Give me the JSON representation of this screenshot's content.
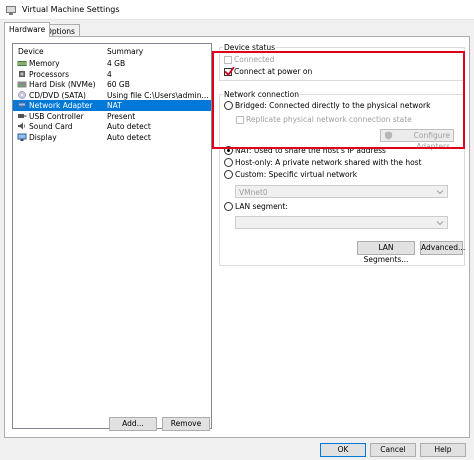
{
  "window": {
    "title": "Virtual Machine Settings"
  },
  "tabs": [
    {
      "label": "Hardware",
      "active": true
    },
    {
      "label": "Options",
      "active": false
    }
  ],
  "device_list": {
    "headers": {
      "device": "Device",
      "summary": "Summary"
    },
    "rows": [
      {
        "device": "Memory",
        "summary": "4 GB",
        "icon": "memory-icon",
        "selected": false
      },
      {
        "device": "Processors",
        "summary": "4",
        "icon": "processor-icon",
        "selected": false
      },
      {
        "device": "Hard Disk (NVMe)",
        "summary": "60 GB",
        "icon": "hard-disk-icon",
        "selected": false
      },
      {
        "device": "CD/DVD (SATA)",
        "summary": "Using file C:\\Users\\admin...",
        "icon": "cd-dvd-icon",
        "selected": false
      },
      {
        "device": "Network Adapter",
        "summary": "NAT",
        "icon": "network-adapter-icon",
        "selected": true
      },
      {
        "device": "USB Controller",
        "summary": "Present",
        "icon": "usb-icon",
        "selected": false
      },
      {
        "device": "Sound Card",
        "summary": "Auto detect",
        "icon": "sound-card-icon",
        "selected": false
      },
      {
        "device": "Display",
        "summary": "Auto detect",
        "icon": "display-icon",
        "selected": false
      }
    ],
    "add_label": "Add...",
    "remove_label": "Remove"
  },
  "device_status": {
    "legend": "Device status",
    "connected_label": "Connected",
    "connected": false,
    "connect_power_label": "Connect at power on",
    "connect_power": true
  },
  "network_connection": {
    "legend": "Network connection",
    "bridged_label": "Bridged: Connected directly to the physical network",
    "replicate_label": "Replicate physical network connection state",
    "configure_adapters_label": "Configure Adapters",
    "nat_label": "NAT: Used to share the host's IP address",
    "host_only_label": "Host-only: A private network shared with the host",
    "custom_label": "Custom: Specific virtual network",
    "custom_value": "VMnet0",
    "lan_segment_label": "LAN segment:",
    "lan_segment_value": "",
    "selected": "nat",
    "lan_segments_button": "LAN Segments...",
    "advanced_button": "Advanced...",
    "highlight_color": "#e0001b"
  },
  "footer": {
    "ok_label": "OK",
    "cancel_label": "Cancel",
    "help_label": "Help"
  }
}
